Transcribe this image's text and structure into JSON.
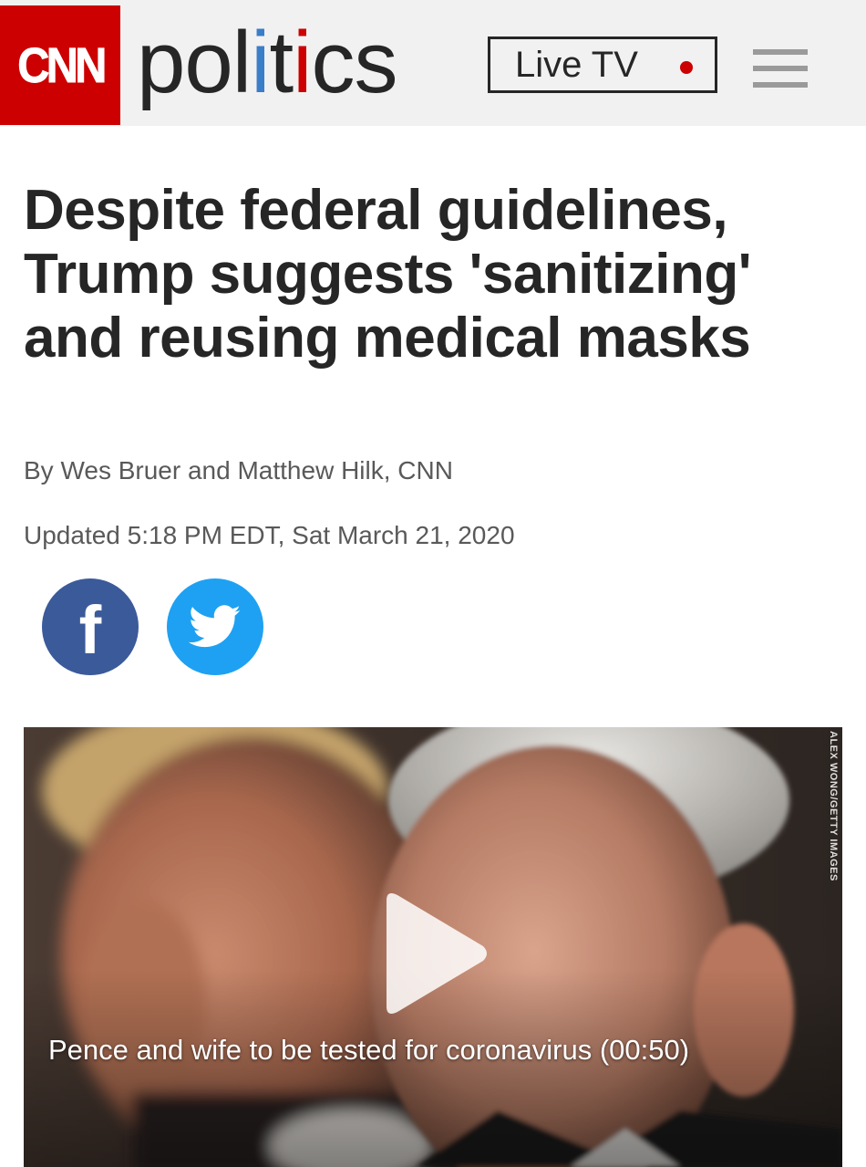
{
  "header": {
    "logo": "CNN",
    "section_parts": [
      "pol",
      "i",
      "t",
      "i",
      "cs"
    ],
    "live_tv_label": "Live TV",
    "menu_icon": "hamburger-menu-icon"
  },
  "article": {
    "headline": "Despite federal guidelines, Trump suggests 'sanitizing' and reusing medical masks",
    "byline": "By Wes Bruer and Matthew Hilk, CNN",
    "updated": "Updated 5:18 PM EDT, Sat March 21, 2020"
  },
  "share": {
    "facebook_icon": "facebook-icon",
    "twitter_icon": "twitter-icon"
  },
  "video": {
    "caption": "Pence and wife to be tested for coronavirus (00:50)",
    "photo_credit": "ALEX WONG/GETTY IMAGES",
    "play_icon": "play-icon"
  },
  "colors": {
    "brand_red": "#cc0000",
    "header_bg": "#f1f1f1",
    "facebook_blue": "#3b5a9a",
    "twitter_blue": "#1ea1f2",
    "text_dark": "#262626",
    "text_meta": "#595959"
  }
}
